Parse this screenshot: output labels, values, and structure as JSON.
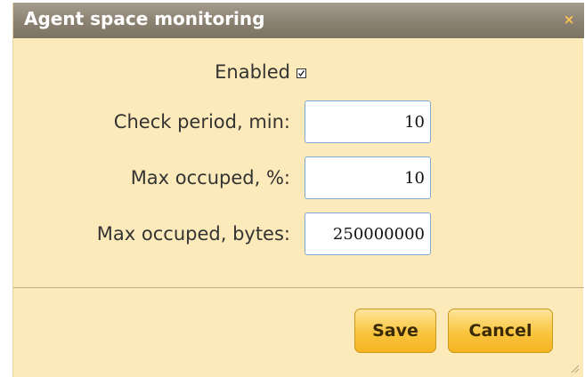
{
  "dialog": {
    "title": "Agent space monitoring",
    "close_glyph": "×",
    "close_icon": "close-icon"
  },
  "form": {
    "enabled": {
      "label": "Enabled",
      "checked": true
    },
    "check_period": {
      "label": "Check period, min:",
      "value": "10"
    },
    "max_occupied_percent": {
      "label": "Max occuped, %:",
      "value": "10"
    },
    "max_occupied_bytes": {
      "label": "Max occuped, bytes:",
      "value": "250000000"
    }
  },
  "buttons": {
    "save_label": "Save",
    "cancel_label": "Cancel"
  },
  "colors": {
    "titlebar": "#8b8171",
    "body": "#fdeaba",
    "button_accent": "#f9c53f",
    "input_border": "#7fa8d4"
  }
}
